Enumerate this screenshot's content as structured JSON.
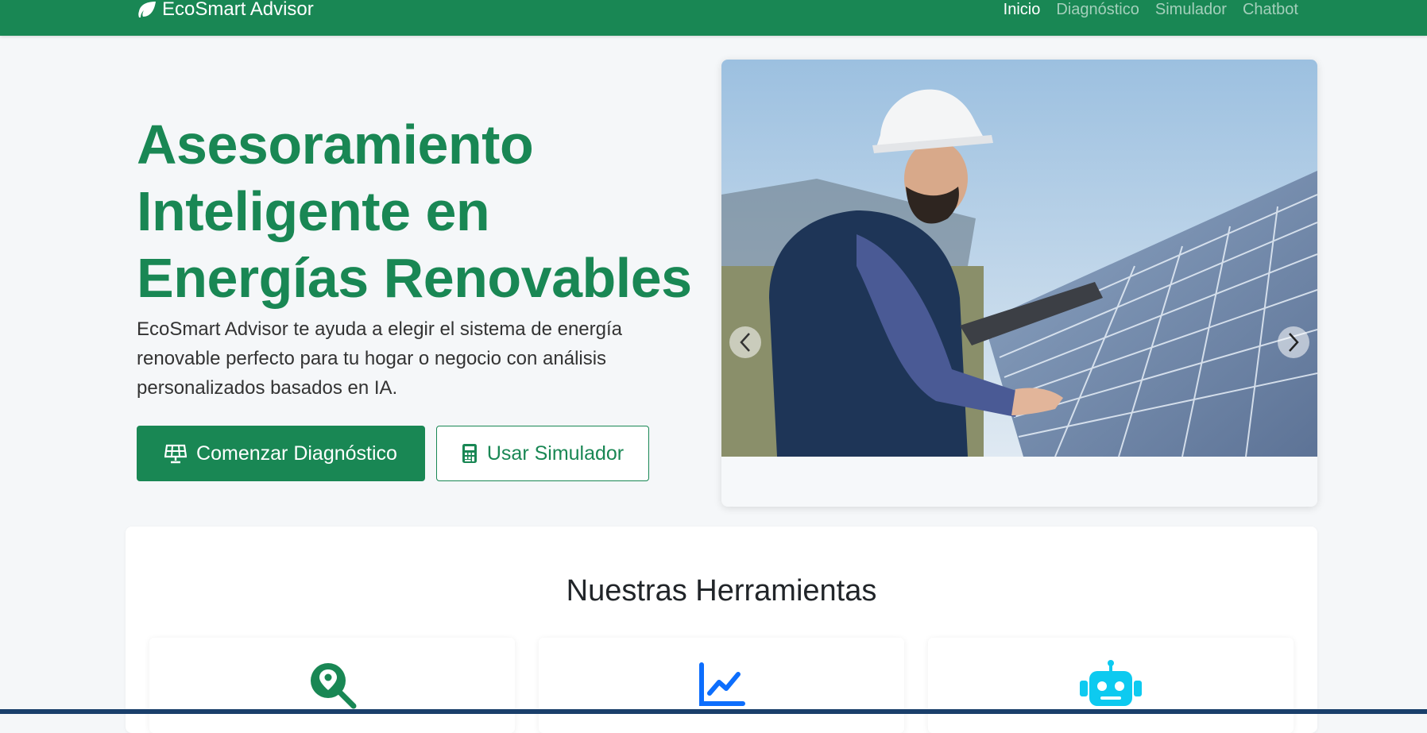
{
  "brand": {
    "name": "EcoSmart Advisor",
    "icon": "leaf-icon"
  },
  "nav": {
    "items": [
      {
        "label": "Inicio",
        "active": true
      },
      {
        "label": "Diagnóstico",
        "active": false
      },
      {
        "label": "Simulador",
        "active": false
      },
      {
        "label": "Chatbot",
        "active": false
      }
    ]
  },
  "hero": {
    "title_line1": "Asesoramiento",
    "title_line2": "Inteligente en",
    "title_line3": "Energías Renovables",
    "description": "EcoSmart Advisor te ayuda a elegir el sistema de energía renovable perfecto para tu hogar o negocio con análisis personalizados basados en IA.",
    "primary_button": {
      "label": "Comenzar Diagnóstico",
      "icon": "solar-panel-icon"
    },
    "secondary_button": {
      "label": "Usar Simulador",
      "icon": "calculator-icon"
    }
  },
  "carousel": {
    "slide_count": 7,
    "active_index": 6
  },
  "tools": {
    "title": "Nuestras Herramientas",
    "cards": [
      {
        "icon": "search-location-icon",
        "color": "#198754"
      },
      {
        "icon": "chart-line-icon",
        "color": "#0d6efd"
      },
      {
        "icon": "robot-icon",
        "color": "#0dcaf0"
      }
    ]
  },
  "colors": {
    "primary": "#198754",
    "background": "#f5f7f9"
  }
}
